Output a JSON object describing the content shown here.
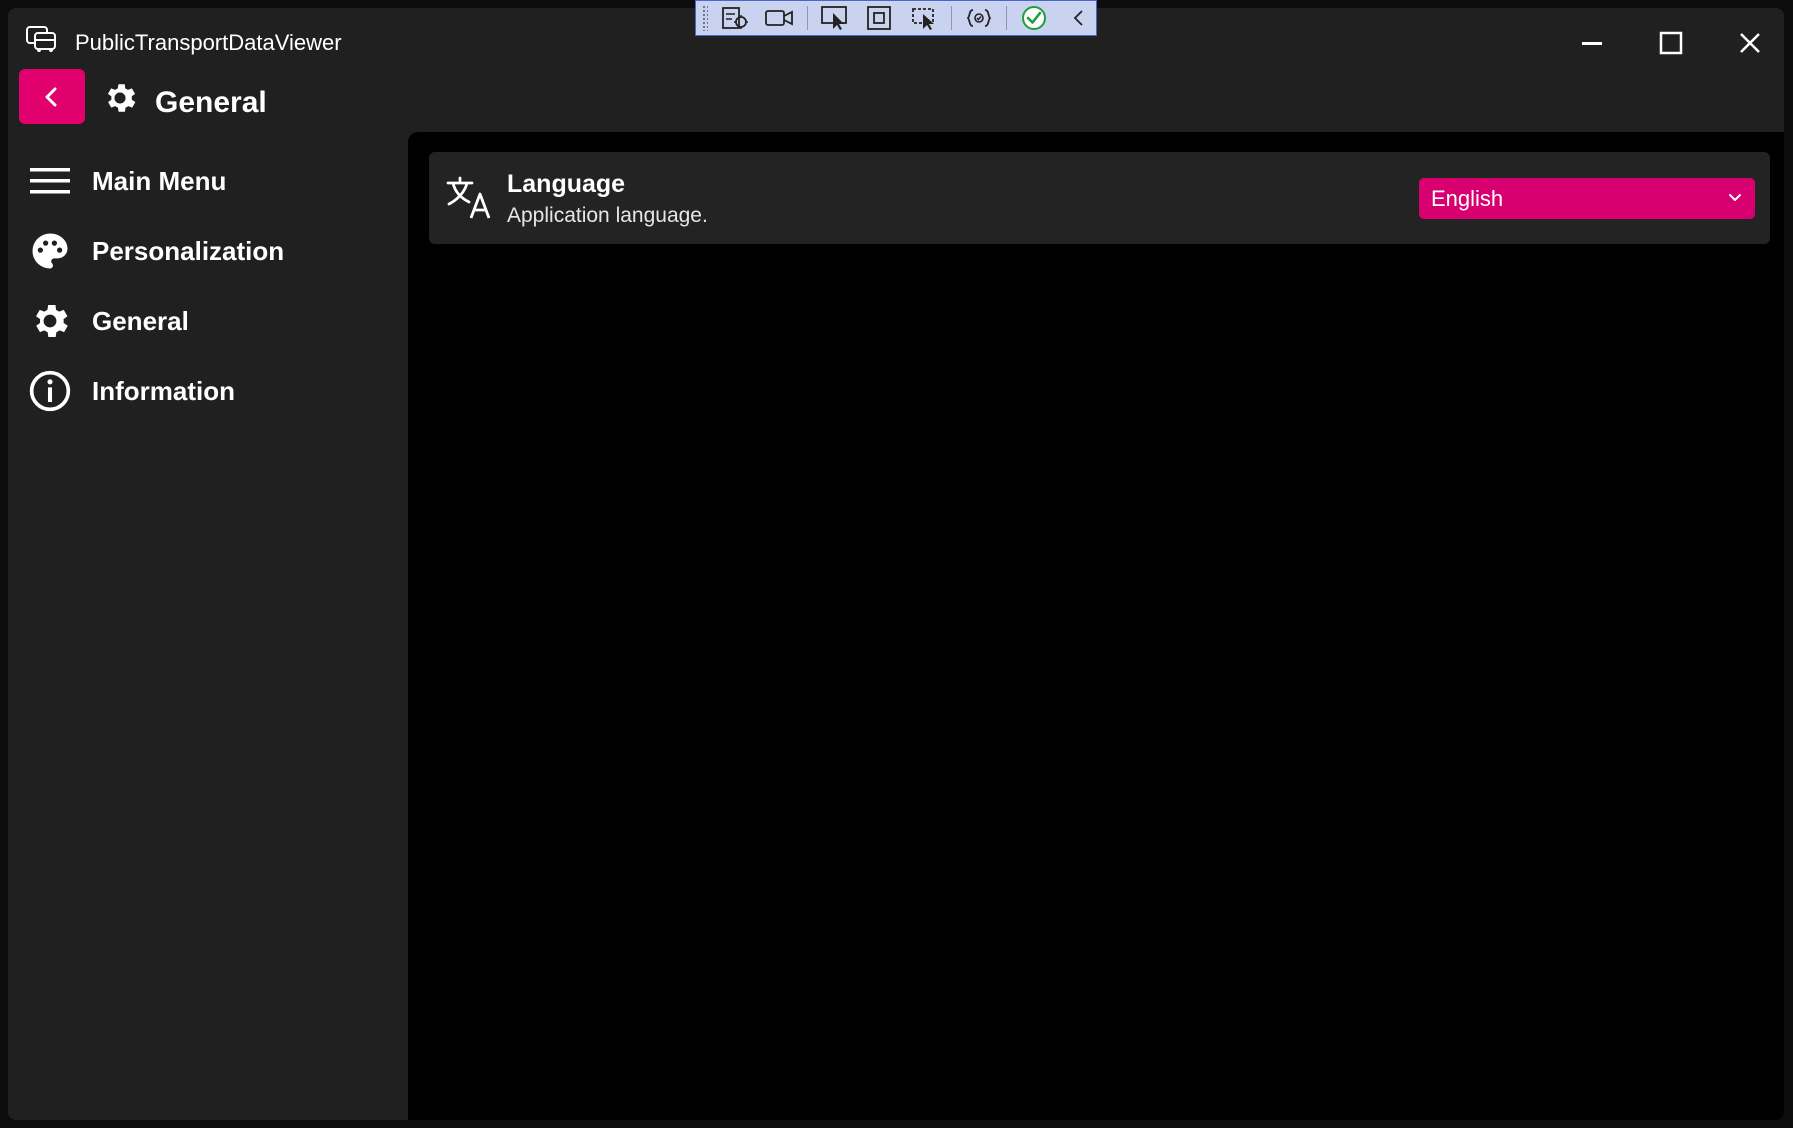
{
  "window": {
    "title": "PublicTransportDataViewer"
  },
  "devtools": {
    "tools": [
      "live-visual-tree-icon",
      "record-icon",
      "select-element-icon",
      "display-layout-adorners-icon",
      "track-focus-icon",
      "binding-failures-icon",
      "hot-reload-ok-icon",
      "collapse-icon"
    ]
  },
  "header": {
    "title": "General"
  },
  "sidebar": {
    "items": [
      {
        "label": "Main Menu",
        "icon": "hamburger-menu-icon"
      },
      {
        "label": "Personalization",
        "icon": "palette-icon"
      },
      {
        "label": "General",
        "icon": "gear-icon"
      },
      {
        "label": "Information",
        "icon": "info-icon"
      }
    ]
  },
  "settings": {
    "language": {
      "title": "Language",
      "description": "Application language.",
      "selected": "English"
    }
  },
  "colors": {
    "accent": "#e0006e",
    "window_bg": "#202020",
    "content_bg": "#000000",
    "card_bg": "#232323"
  }
}
